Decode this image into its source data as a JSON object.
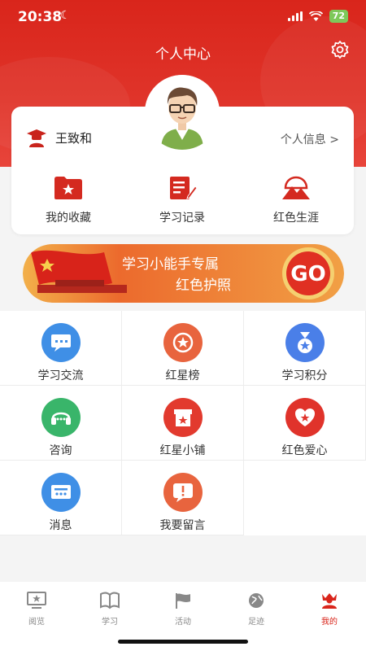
{
  "status_bar": {
    "time": "20:38",
    "battery": "72"
  },
  "header": {
    "title": "个人中心"
  },
  "profile": {
    "name": "王致和",
    "info_link": "个人信息 >"
  },
  "quick_actions": [
    {
      "label": "我的收藏",
      "icon": "folder-star-icon"
    },
    {
      "label": "学习记录",
      "icon": "notebook-pen-icon"
    },
    {
      "label": "红色生涯",
      "icon": "mountain-flag-icon"
    }
  ],
  "banner": {
    "line1": "学习小能手专属",
    "line2": "红色护照",
    "go": "GO"
  },
  "grid": [
    {
      "label": "学习交流",
      "icon": "chat-screen-icon",
      "color": "#3f8fe6"
    },
    {
      "label": "红星榜",
      "icon": "star-medal-icon",
      "color": "#e8643e"
    },
    {
      "label": "学习积分",
      "icon": "medal-ribbon-icon",
      "color": "#4a7fe8"
    },
    {
      "label": "咨询",
      "icon": "headset-icon",
      "color": "#39b56a"
    },
    {
      "label": "红星小铺",
      "icon": "shop-icon",
      "color": "#e23a2e"
    },
    {
      "label": "红色爱心",
      "icon": "heart-star-icon",
      "color": "#e0332b"
    },
    {
      "label": "消息",
      "icon": "message-icon",
      "color": "#3f8fe6"
    },
    {
      "label": "我要留言",
      "icon": "alert-bubble-icon",
      "color": "#e8643e"
    }
  ],
  "tabs": [
    {
      "label": "阅览",
      "icon": "monitor-star-icon",
      "active": false
    },
    {
      "label": "学习",
      "icon": "book-icon",
      "active": false
    },
    {
      "label": "活动",
      "icon": "flag-icon",
      "active": false
    },
    {
      "label": "足迹",
      "icon": "globe-icon",
      "active": false
    },
    {
      "label": "我的",
      "icon": "crown-person-icon",
      "active": true
    }
  ],
  "colors": {
    "brand_red": "#d9251b",
    "inactive_gray": "#888888"
  }
}
